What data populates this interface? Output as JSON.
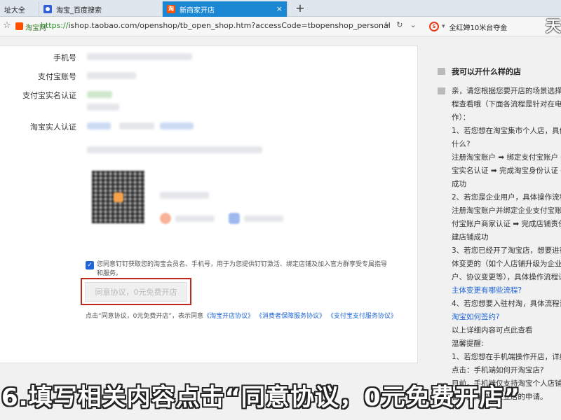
{
  "tabs": [
    {
      "label": "址大全"
    },
    {
      "label": "淘宝_百度搜索"
    },
    {
      "label": "新商家开店",
      "favicon_text": "淘"
    }
  ],
  "tab_close": "×",
  "new_tab": "+",
  "address_bar": {
    "site_name": "淘宝网",
    "url_proto": "https://",
    "url_rest": "ishop.taobao.com/openshop/tb_open_shop.htm?accessCode=tbopenshop_personal",
    "search_logo": "S",
    "search_text": "全红婵10米台夺金"
  },
  "top_right_char": "天",
  "form": {
    "labels": [
      "手机号",
      "支付宝账号",
      "支付宝实名认证",
      "淘宝实人认证"
    ],
    "consent_text": "您同意钉钉获取您的淘宝会员名、手机号，用于为您提供钉钉激活、绑定店铺及加入官方群享受专属指导和服务。",
    "check_mark": "✓",
    "agree_button": "同意协议，0元免费开店",
    "agreements_prefix": "点击“同意协议，0元免费开店”，表示同意",
    "agreement_links": [
      "《淘宝开店协议》",
      "《消费者保障服务协议》",
      "《支付宝支付服务协议》"
    ]
  },
  "side_panel": {
    "title": "我可以开什么样的店",
    "lines": [
      {
        "text": "亲，请您根据您要开店的场景选择以",
        "link": false
      },
      {
        "text": "程查看哦（下面各流程是针对在电脑",
        "link": false
      },
      {
        "text": "作）：",
        "link": false
      },
      {
        "text": "1、若您想在淘宝集市个人店，具体",
        "link": false
      },
      {
        "text": "什么?",
        "link": false
      },
      {
        "text": "注册淘宝账户 ➡ 绑定支付宝账户 ➡",
        "link": false
      },
      {
        "text": "宝实名认证 ➡ 完成淘宝身份认证 ➡",
        "link": false
      },
      {
        "text": "成功",
        "link": false
      },
      {
        "text": "2、若您是企业用户，具体操作流程",
        "link": false
      },
      {
        "text": "注册淘宝账户并绑定企业支付宝账户",
        "link": false
      },
      {
        "text": "付宝账户商家认证 ➡ 完成店铺责任",
        "link": false
      },
      {
        "text": "建店铺成功",
        "link": false
      },
      {
        "text": "3、若您已经开了淘宝店，想要进行",
        "link": false
      },
      {
        "text": "体变更的（如个人店铺升级为企业店",
        "link": false
      },
      {
        "text": "户、协议变更等），具体操作流程请",
        "link": false
      },
      {
        "text": "主体变更有哪些流程?",
        "link": true
      },
      {
        "text": "4、若您想要入驻村淘，具体流程请",
        "link": false
      },
      {
        "text": "淘宝如何签约?",
        "link": true
      },
      {
        "text": "以上详细内容可点此查看",
        "link": false
      },
      {
        "text": "温馨提醒:",
        "link": false
      },
      {
        "text": "1、若您想在手机端操作开店，详细",
        "link": false
      },
      {
        "text": "点击：手机端如何开淘宝店?",
        "link": false
      },
      {
        "text": "目前，手机端仅支持淘宝个人店铺申",
        "link": false
      },
      {
        "text": "暂不支持淘宝企业店的申请。",
        "link": false
      }
    ]
  },
  "caption": "6.填写相关内容点击“同意协议，0元免费开店”",
  "colors": {
    "accent_blue": "#1b86d1",
    "link_blue": "#1e66d8",
    "highlight_red": "#c0281e",
    "taobao_orange": "#ff5000"
  }
}
